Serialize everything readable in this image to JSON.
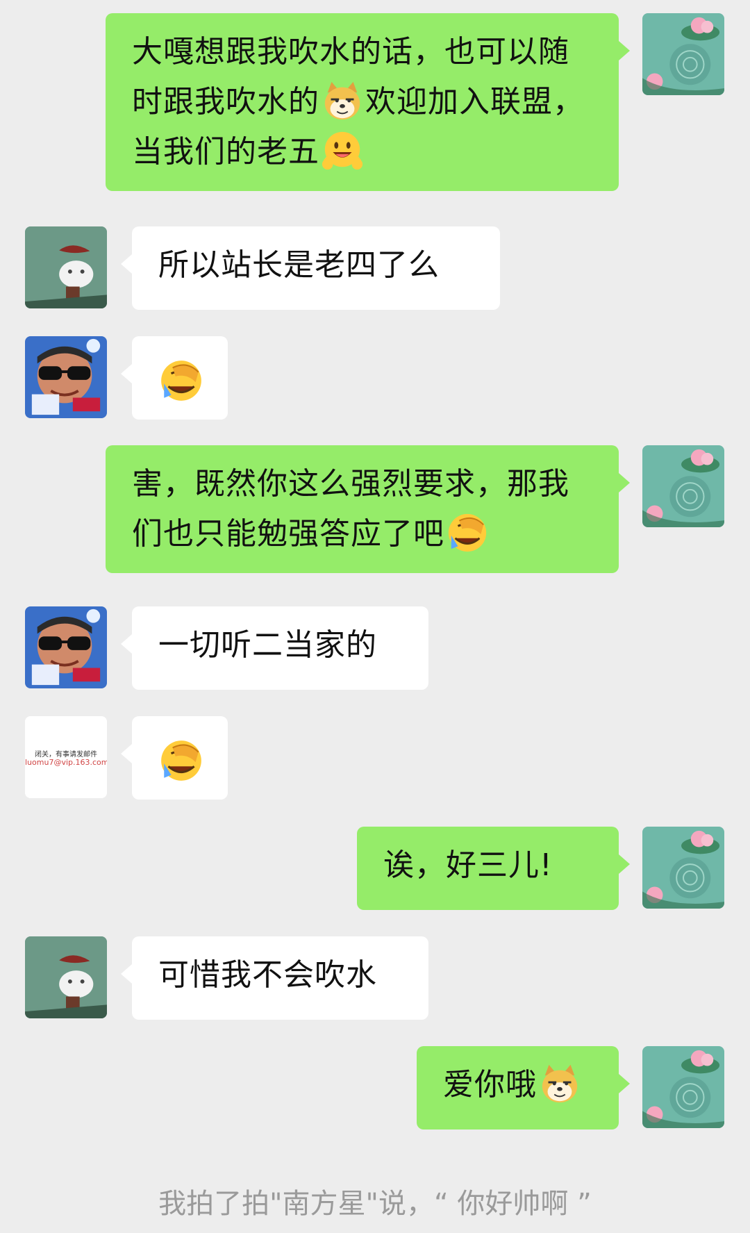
{
  "messages": [
    {
      "from": "me",
      "parts": [
        "大嘎想跟我吹水的话，也可以随时跟我吹水的",
        "[doge]",
        "欢迎加入联盟，当我们的老五",
        "[grin]"
      ]
    },
    {
      "from": "user-a",
      "text": "所以站长是老四了么"
    },
    {
      "from": "user-b",
      "emoji": "[facepalm-cry]"
    },
    {
      "from": "me",
      "parts": [
        "害，既然你这么强烈要求，那我们也只能勉强答应了吧",
        "[facepalm-cry]"
      ]
    },
    {
      "from": "user-b",
      "text": "一切听二当家的"
    },
    {
      "from": "user-c",
      "emoji": "[facepalm-cry]"
    },
    {
      "from": "me",
      "text": "诶，好三儿!"
    },
    {
      "from": "user-a",
      "text": "可惜我不会吹水"
    },
    {
      "from": "me",
      "parts": [
        "爱你哦",
        "[doge]"
      ]
    }
  ],
  "avatars": {
    "user_c_text_line1": "闭关，有事请发邮件",
    "user_c_text_line2": "luomu7@vip.163.com"
  },
  "system_message": "我拍了拍\"南方星\"说，“ 你好帅啊 ”",
  "colors": {
    "background": "#ededed",
    "my_bubble": "#95ec69",
    "other_bubble": "#ffffff",
    "system_text": "#9a9a9a"
  },
  "icons": [
    "doge-emoji-icon",
    "grin-emoji-icon",
    "facepalm-cry-emoji-icon",
    "lotus-avatar-icon",
    "rabbit-avatar-icon",
    "sunglasses-avatar-icon",
    "text-avatar-icon"
  ]
}
